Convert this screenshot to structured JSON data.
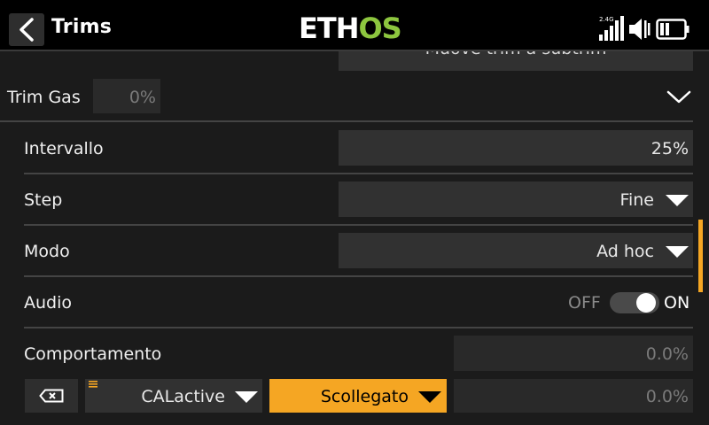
{
  "header": {
    "title": "Trims",
    "logo_part1": "ETH",
    "logo_part2": "OS",
    "signal_label": "2.4G"
  },
  "partial_top_button": "Muove trim a subtrim",
  "trim_gas": {
    "label": "Trim Gas",
    "value": "0%"
  },
  "rows": {
    "intervallo": {
      "label": "Intervallo",
      "value": "25%"
    },
    "step": {
      "label": "Step",
      "value": "Fine"
    },
    "modo": {
      "label": "Modo",
      "value": "Ad hoc"
    },
    "audio": {
      "label": "Audio",
      "off": "OFF",
      "on": "ON",
      "state": "on"
    },
    "comportamento": {
      "label": "Comportamento",
      "value": "0.0%"
    }
  },
  "bottom_row": {
    "source": "CALactive",
    "function": "Scollegato",
    "value": "0.0%"
  },
  "colors": {
    "accent": "#f5a623",
    "logo_green": "#8dc63f",
    "field_bg": "#313131",
    "page_bg": "#1b1b1b"
  }
}
